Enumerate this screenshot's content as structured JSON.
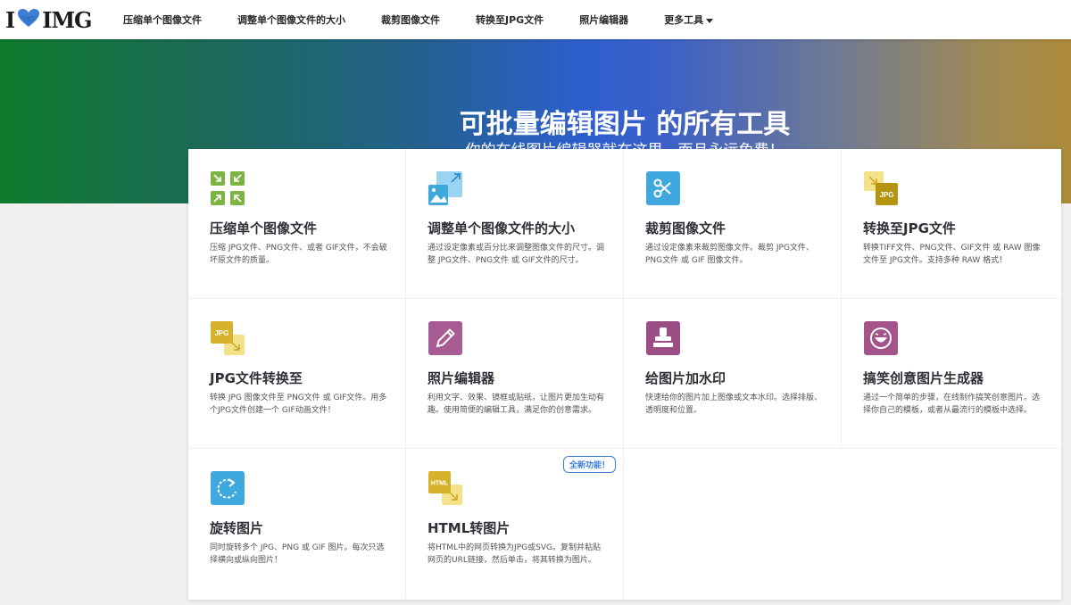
{
  "nav": {
    "logo_left": "I",
    "logo_right": "IMG",
    "links": [
      "压缩单个图像文件",
      "调整单个图像文件的大小",
      "裁剪图像文件",
      "转换至JPG文件",
      "照片编辑器",
      "更多工具"
    ]
  },
  "hero": {
    "title": "可批量编辑图片 的所有工具",
    "subtitle": "你的在线图片编辑器就在这里，而且永远免费！"
  },
  "tools": [
    {
      "title": "压缩单个图像文件",
      "desc": "压缩 JPG文件、PNG文件、或者 GIF文件，不会破坏原文件的质量。",
      "icon": "compress-icon",
      "color": "#7cb342"
    },
    {
      "title": "调整单个图像文件的大小",
      "desc": "通过设定像素或百分比来调整图像文件的尺寸。调整 JPG文件、PNG文件 或 GIF文件的尺寸。",
      "icon": "resize-icon",
      "color": "#5bb5e8"
    },
    {
      "title": "裁剪图像文件",
      "desc": "通过设定像素来裁剪图像文件。裁剪 JPG文件、PNG文件 或 GIF 图像文件。",
      "icon": "crop-icon",
      "color": "#3fa9dd"
    },
    {
      "title": "转换至JPG文件",
      "desc": "转换TIFF文件、PNG文件、GIF文件 或 RAW 图像文件至 JPG文件。支持多种 RAW 格式！",
      "icon": "convert-to-jpg-icon",
      "color": "#c9a623"
    },
    {
      "title": "JPG文件转换至",
      "desc": "转换 JPG 图像文件至 PNG文件 或 GIF文件。用多个JPG文件创建一个 GIF动画文件！",
      "icon": "convert-from-jpg-icon",
      "color": "#d6b22b"
    },
    {
      "title": "照片编辑器",
      "desc": "利用文字、效果、镜框或贴纸，让图片更加生动有趣。使用简便的编辑工具，满足你的创意需求。",
      "icon": "edit-icon",
      "color": "#a65b92"
    },
    {
      "title": "给图片加水印",
      "desc": "快速给你的图片加上图像或文本水印。选择排版、透明度和位置。",
      "icon": "watermark-icon",
      "color": "#9b4d86"
    },
    {
      "title": "搞笑创意图片生成器",
      "desc": "通过一个简单的步骤，在线制作搞笑创意图片。选择你自己的模板，或者从最流行的模板中选择。",
      "icon": "meme-icon",
      "color": "#a4548a"
    },
    {
      "title": "旋转图片",
      "desc": "同时旋转多个 JPG、PNG 或 GIF 图片。每次只选择横向或纵向图片！",
      "icon": "rotate-icon",
      "color": "#3fa9dd"
    },
    {
      "title": "HTML转图片",
      "desc": "将HTML中的网页转换为JPG或SVG。复制并粘贴网页的URL链接，然后单击，将其转换为图片。",
      "icon": "html-to-image-icon",
      "color": "#d6b22b",
      "badge": "全新功能！"
    }
  ]
}
